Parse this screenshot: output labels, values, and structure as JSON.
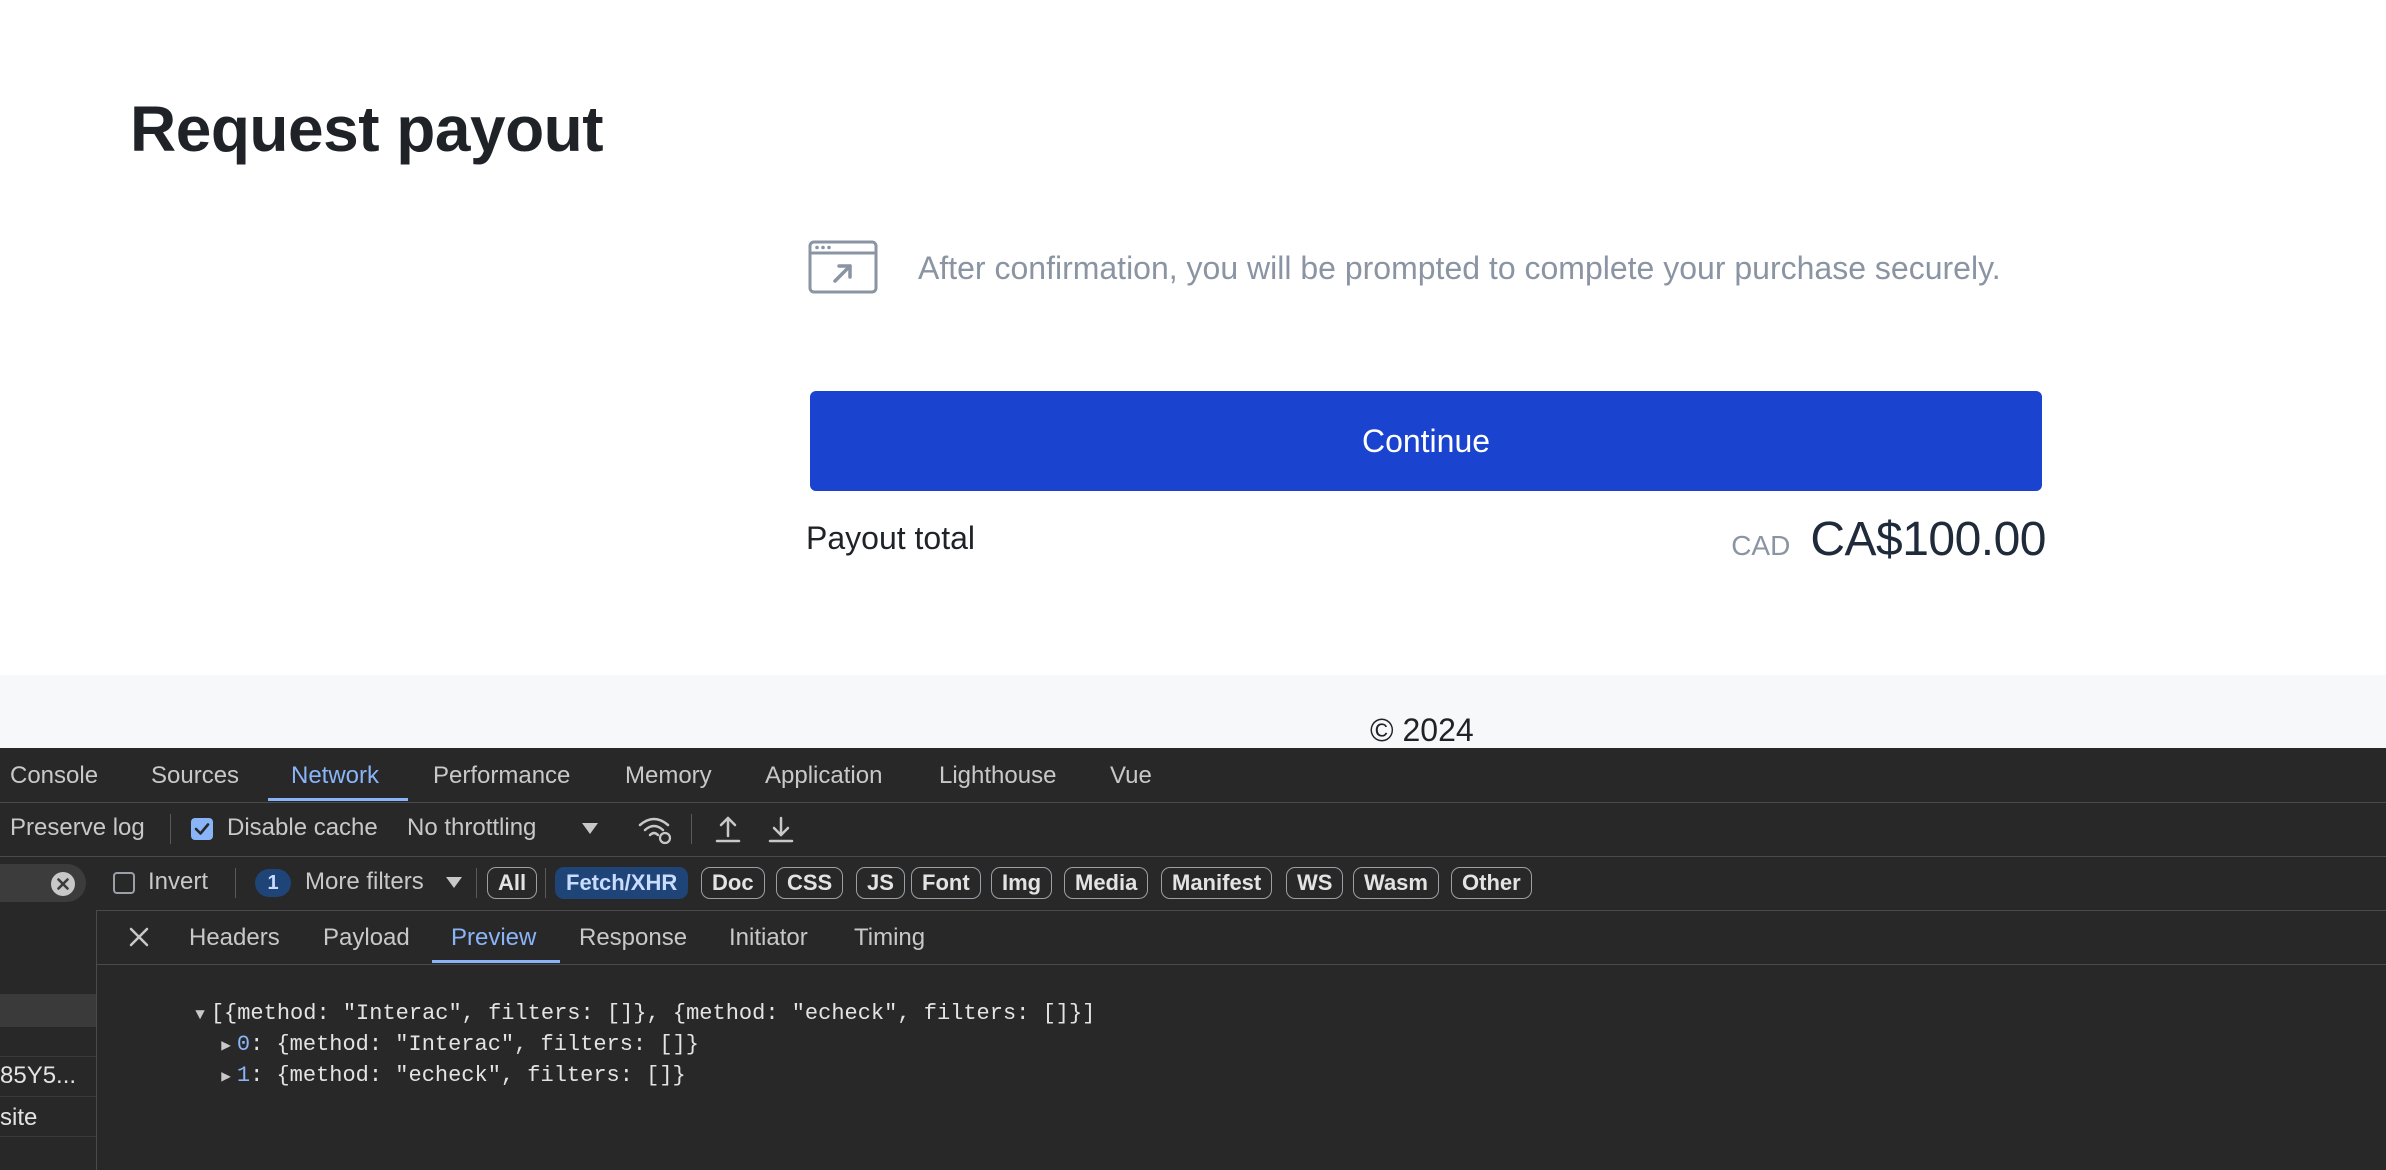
{
  "page": {
    "title": "Request payout",
    "notice_text": "After confirmation, you will be prompted to complete your purchase securely.",
    "continue_label": "Continue",
    "payout_label": "Payout total",
    "currency_code": "CAD",
    "amount": "CA$100.00",
    "copyright": "© 2024"
  },
  "devtools": {
    "tabs": [
      "Console",
      "Sources",
      "Network",
      "Performance",
      "Memory",
      "Application",
      "Lighthouse",
      "Vue"
    ],
    "active_tab": "Network",
    "toolbar": {
      "preserve_log": "Preserve log",
      "disable_cache": "Disable cache",
      "throttling": "No throttling"
    },
    "filters": {
      "invert": "Invert",
      "badge_count": "1",
      "more_filters": "More filters",
      "types": [
        "All",
        "Fetch/XHR",
        "Doc",
        "CSS",
        "JS",
        "Font",
        "Img",
        "Media",
        "Manifest",
        "WS",
        "Wasm",
        "Other"
      ],
      "active_type": "Fetch/XHR"
    },
    "subtabs": [
      "Headers",
      "Payload",
      "Preview",
      "Response",
      "Initiator",
      "Timing"
    ],
    "active_subtab": "Preview",
    "request_list": [
      "85Y5...",
      "site"
    ],
    "preview": {
      "summary": "[{method: \"Interac\", filters: []}, {method: \"echeck\", filters: []}]",
      "items": [
        {
          "key": "0",
          "value": ": {method: \"Interac\", filters: []}"
        },
        {
          "key": "1",
          "value": ": {method: \"echeck\", filters: []}"
        }
      ]
    }
  },
  "colors": {
    "primary_button": "#1a43cf",
    "devtools_bg": "#282828",
    "devtools_accent": "#8ab4f8"
  }
}
